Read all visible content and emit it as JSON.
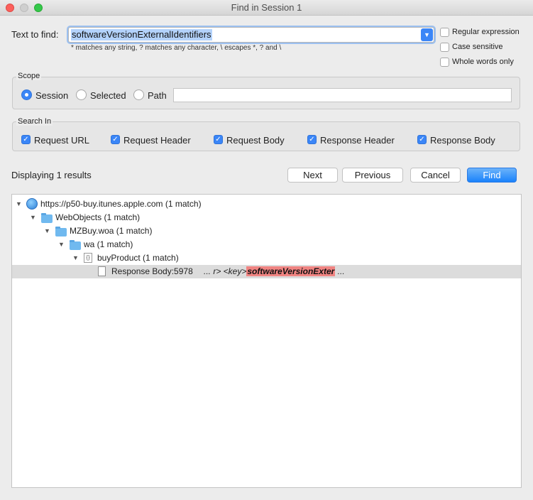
{
  "window": {
    "title": "Find in Session 1"
  },
  "find": {
    "label": "Text to find:",
    "value": "softwareVersionExternalIdentifiers",
    "hint": "* matches any string, ? matches any character, \\ escapes *, ? and \\",
    "dropdown_icon": "chevron-down-icon"
  },
  "options": {
    "regex": "Regular expression",
    "case": "Case sensitive",
    "whole": "Whole words only"
  },
  "scope": {
    "title": "Scope",
    "session": "Session",
    "selected": "Selected",
    "path": "Path",
    "path_value": ""
  },
  "search_in": {
    "title": "Search In",
    "request_url": "Request URL",
    "request_header": "Request Header",
    "request_body": "Request Body",
    "response_header": "Response Header",
    "response_body": "Response Body"
  },
  "results": {
    "status": "Displaying 1 results",
    "next": "Next",
    "previous": "Previous",
    "cancel": "Cancel",
    "find": "Find"
  },
  "tree": {
    "host": "https://p50-buy.itunes.apple.com (1 match)",
    "webobjects": "WebObjects (1 match)",
    "mzbuy": "MZBuy.woa (1 match)",
    "wa": "wa (1 match)",
    "buyproduct": "buyProduct (1 match)",
    "result_label": "Response Body:5978",
    "snippet_pre": "... r> <key>",
    "snippet_match": "softwareVersionExter",
    "snippet_post": " ..."
  },
  "colors": {
    "accent": "#3b86f7",
    "match": "#f08482",
    "highlight_row": "#dcdcdc"
  }
}
